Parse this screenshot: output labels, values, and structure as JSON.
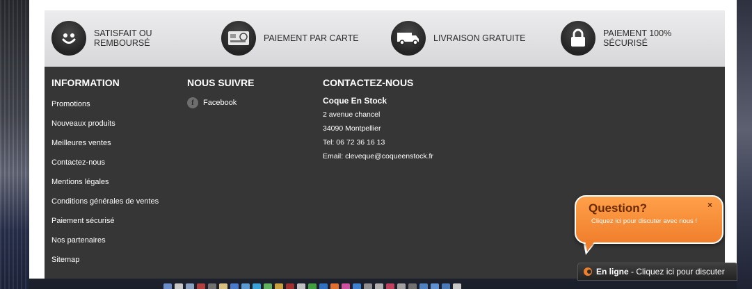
{
  "reassurance": [
    {
      "icon": "smiley-icon",
      "text": "SATISFAIT OU REMBOURSÉ"
    },
    {
      "icon": "credit-card-icon",
      "text": "PAIEMENT PAR CARTE"
    },
    {
      "icon": "delivery-truck-icon",
      "text": "LIVRAISON GRATUITE"
    },
    {
      "icon": "padlock-icon",
      "text": "PAIEMENT 100% SÉCURISÉ"
    }
  ],
  "information": {
    "title": "INFORMATION",
    "links": [
      "Promotions",
      "Nouveaux produits",
      "Meilleures ventes",
      "Contactez-nous",
      "Mentions légales",
      "Conditions générales de ventes",
      "Paiement sécurisé",
      "Nos partenaires",
      "Sitemap"
    ]
  },
  "follow": {
    "title": "NOUS SUIVRE",
    "facebook_label": "Facebook",
    "facebook_glyph": "f"
  },
  "contact": {
    "title": "CONTACTEZ-NOUS",
    "company": "Coque En Stock",
    "address": "2 avenue chancel",
    "city": "34090 Montpellier",
    "phone": "Tel: 06 72 36 16 13",
    "email": "Email: cleveque@coqueenstock.fr"
  },
  "chat": {
    "bubble_title": "Question?",
    "bubble_subtitle": "Cliquez ici pour discuter avec nous !",
    "close_label": "×",
    "bar_status": "En ligne",
    "bar_text": " - Cliquez ici pour discuter"
  },
  "colors": {
    "footer_bg": "#363636",
    "chat_orange": "#f07f2c"
  }
}
